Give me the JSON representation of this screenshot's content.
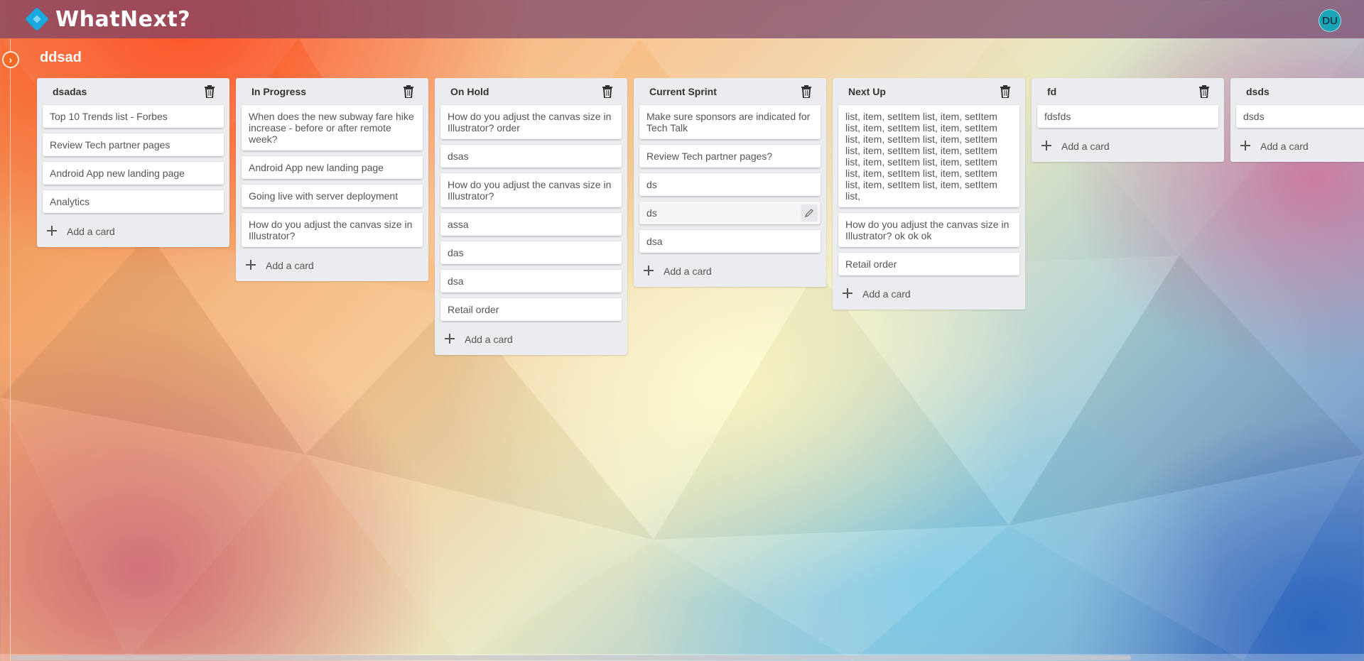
{
  "app": {
    "name": "WhatNext?"
  },
  "user": {
    "initials": "DU"
  },
  "board": {
    "title": "ddsad"
  },
  "icons": {
    "trash": "trash-icon",
    "plus": "plus-icon",
    "edit": "pencil-icon",
    "toggle": "chevron-right-icon"
  },
  "add_card_label": "Add a card",
  "lists": [
    {
      "title": "dsadas",
      "cards": [
        "Top 10 Trends list - Forbes",
        "Review Tech partner pages",
        "Android App new landing page",
        "Analytics"
      ]
    },
    {
      "title": "In Progress",
      "cards": [
        "When does the new subway fare hike increase - before or after remote week?",
        "Android App new landing page",
        "Going live with server deployment",
        "How do you adjust the canvas size in Illustrator?"
      ]
    },
    {
      "title": "On Hold",
      "cards": [
        "How do you adjust the canvas size in Illustrator? order",
        "dsas",
        "How do you adjust the canvas size in Illustrator?",
        "assa",
        "das",
        "dsa",
        "Retail order"
      ]
    },
    {
      "title": "Current Sprint",
      "cards": [
        "Make sure sponsors are indicated for Tech Talk",
        "Review Tech partner pages?",
        "ds",
        "ds",
        "dsa"
      ]
    },
    {
      "title": "Next Up",
      "cards": [
        "list, item, setItem list, item, setItem list, item, setItem list, item, setItem list, item, setItem list, item, setItem list, item, setItem list, item, setItem list, item, setItem list, item, setItem list, item, setItem list, item, setItem list, item, setItem list, item, setItem list,",
        "How do you adjust the canvas size in Illustrator? ok ok ok",
        "Retail order"
      ]
    },
    {
      "title": "fd",
      "cards": [
        "fdsfds"
      ]
    },
    {
      "title": "dsds",
      "cards": [
        "dsds"
      ]
    }
  ]
}
